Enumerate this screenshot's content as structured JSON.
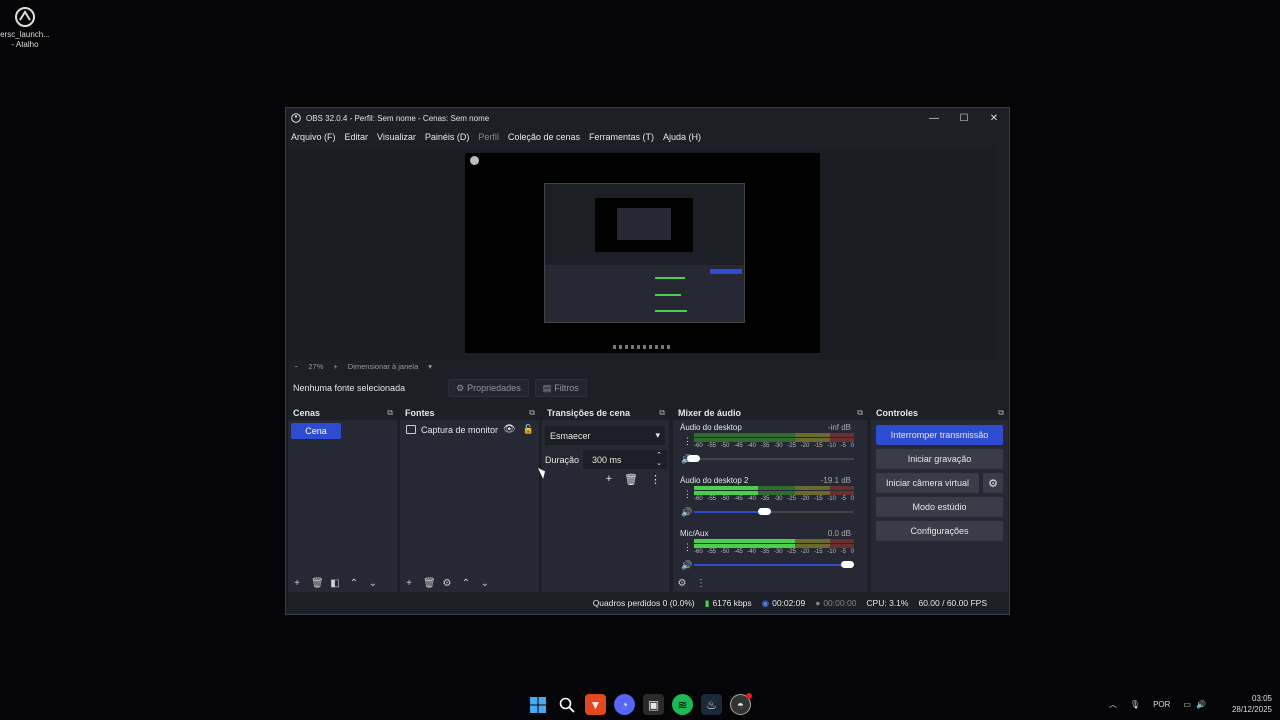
{
  "desktop": {
    "shortcut_label": "ersc_launch... - Atalho"
  },
  "window": {
    "title": "OBS 32.0.4 - Perfil: Sem nome - Cenas: Sem nome",
    "controls": {
      "minimize": "—",
      "maximize": "☐",
      "close": "✕"
    }
  },
  "menu": {
    "items": [
      "Arquivo (F)",
      "Editar",
      "Visualizar",
      "Painéis (D)",
      "Perfil",
      "Coleção de cenas",
      "Ferramentas (T)",
      "Ajuda (H)"
    ]
  },
  "preview": {
    "zoom_minus": "−",
    "zoom_value": "27%",
    "zoom_plus": "+",
    "scale_mode": "Dimensionar à janela",
    "scale_arrow": "▾"
  },
  "props_bar": {
    "no_source": "Nenhuma fonte selecionada",
    "properties": "Propriedades",
    "filters": "Filtros"
  },
  "scenes": {
    "title": "Cenas",
    "items": [
      "Cena"
    ]
  },
  "sources": {
    "title": "Fontes",
    "items": [
      {
        "name": "Captura de monitor"
      }
    ]
  },
  "transitions": {
    "title": "Transições de cena",
    "selected": "Esmaecer",
    "duration_label": "Duração",
    "duration_value": "300 ms"
  },
  "mixer": {
    "title": "Mixer de áudio",
    "scale": [
      "-60",
      "-55",
      "-50",
      "-45",
      "-40",
      "-35",
      "-30",
      "-25",
      "-20",
      "-15",
      "-10",
      "-5",
      "0"
    ],
    "channels": [
      {
        "name": "Áudio do desktop",
        "db": "-inf dB",
        "level": 0.0,
        "volume": 0.04
      },
      {
        "name": "Áudio do desktop 2",
        "db": "-19.1 dB",
        "level": 0.4,
        "volume": 0.48
      },
      {
        "name": "Mic/Aux",
        "db": "0.0 dB",
        "level": 0.63,
        "volume": 1.0
      }
    ]
  },
  "controls": {
    "title": "Controles",
    "stop_stream": "Interromper transmissão",
    "start_recording": "Iniciar gravação",
    "start_virtual_cam": "Iniciar câmera virtual",
    "studio_mode": "Modo estúdio",
    "settings": "Configurações"
  },
  "status": {
    "dropped": "Quadros perdidos 0 (0.0%)",
    "bitrate": "6176 kbps",
    "stream_time": "00:02:09",
    "rec_time": "00:00:00",
    "cpu": "CPU: 3.1%",
    "fps": "60.00 / 60.00 FPS"
  },
  "taskbar": {
    "apps": [
      "windows-start",
      "search",
      "brave",
      "discord",
      "app-five",
      "spotify",
      "steam",
      "obs"
    ],
    "lang": "POR",
    "time": "03:05",
    "date": "28/12/2025"
  },
  "colors": {
    "accent": "#2f4bd0",
    "window_bg": "#1d1f26",
    "dock_bg": "#262833"
  }
}
